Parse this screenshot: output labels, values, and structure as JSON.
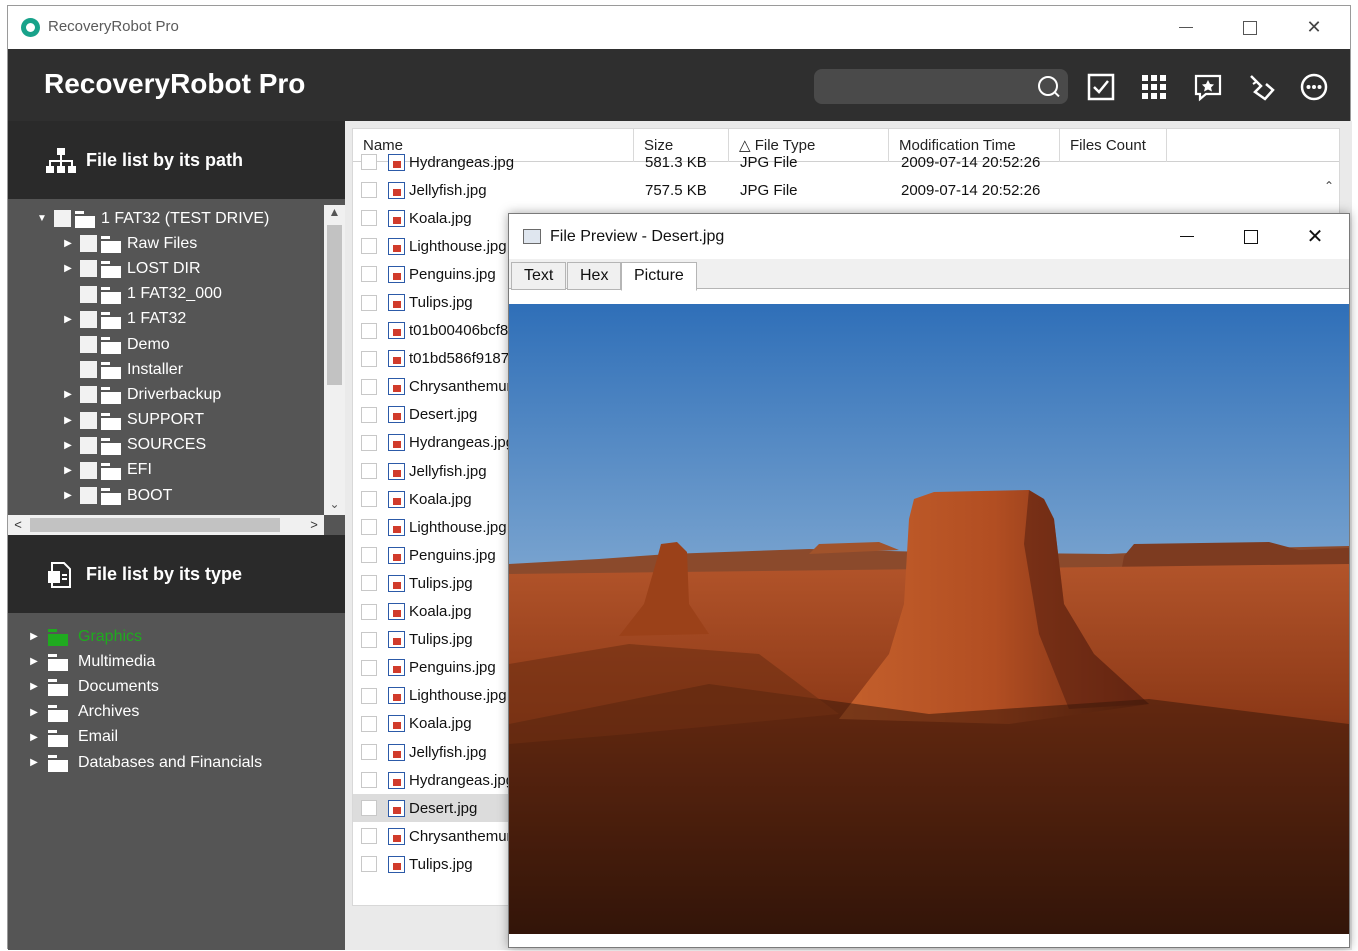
{
  "window": {
    "title": "RecoveryRobot Pro"
  },
  "header": {
    "brand": "RecoveryRobot Pro",
    "search": {
      "placeholder": ""
    },
    "tools": [
      "check-icon",
      "grid-icon",
      "rating-icon",
      "clean-icon",
      "more-icon"
    ]
  },
  "path_panel": {
    "title": "File list by its path",
    "tree": [
      {
        "label": "1 FAT32 (TEST DRIVE)",
        "level": 0,
        "arrow": "▼"
      },
      {
        "label": "Raw Files",
        "level": 1,
        "arrow": "▶"
      },
      {
        "label": "LOST DIR",
        "level": 1,
        "arrow": "▶"
      },
      {
        "label": "1 FAT32_000",
        "level": 1,
        "arrow": ""
      },
      {
        "label": "1 FAT32",
        "level": 1,
        "arrow": "▶"
      },
      {
        "label": "Demo",
        "level": 1,
        "arrow": ""
      },
      {
        "label": "Installer",
        "level": 1,
        "arrow": ""
      },
      {
        "label": "Driverbackup",
        "level": 1,
        "arrow": "▶"
      },
      {
        "label": "SUPPORT",
        "level": 1,
        "arrow": "▶"
      },
      {
        "label": "SOURCES",
        "level": 1,
        "arrow": "▶"
      },
      {
        "label": "EFI",
        "level": 1,
        "arrow": "▶"
      },
      {
        "label": "BOOT",
        "level": 1,
        "arrow": "▶"
      }
    ]
  },
  "type_panel": {
    "title": "File list by its type",
    "items": [
      {
        "label": "Graphics",
        "color": "#1faa1f"
      },
      {
        "label": "Multimedia",
        "color": "#ffffff"
      },
      {
        "label": "Documents",
        "color": "#ffffff"
      },
      {
        "label": "Archives",
        "color": "#ffffff"
      },
      {
        "label": "Email",
        "color": "#ffffff"
      },
      {
        "label": "Databases and Financials",
        "color": "#ffffff"
      }
    ]
  },
  "file_list": {
    "columns": [
      "Name",
      "Size",
      "△ File Type",
      "Modification Time",
      "Files Count"
    ],
    "rows": [
      {
        "name": "Hydrangeas.jpg",
        "size": "581.3 KB",
        "type": "JPG File",
        "modified": "2009-07-14 20:52:26"
      },
      {
        "name": "Jellyfish.jpg",
        "size": "757.5 KB",
        "type": "JPG File",
        "modified": "2009-07-14 20:52:26"
      },
      {
        "name": "Koala.jpg",
        "size": "",
        "type": "",
        "modified": ""
      },
      {
        "name": "Lighthouse.jpg",
        "size": "",
        "type": "",
        "modified": ""
      },
      {
        "name": "Penguins.jpg",
        "size": "",
        "type": "",
        "modified": ""
      },
      {
        "name": "Tulips.jpg",
        "size": "",
        "type": "",
        "modified": ""
      },
      {
        "name": "t01b00406bcf8",
        "size": "",
        "type": "",
        "modified": ""
      },
      {
        "name": "t01bd586f9187",
        "size": "",
        "type": "",
        "modified": ""
      },
      {
        "name": "Chrysanthemum",
        "size": "",
        "type": "",
        "modified": ""
      },
      {
        "name": "Desert.jpg",
        "size": "",
        "type": "",
        "modified": ""
      },
      {
        "name": "Hydrangeas.jpg",
        "size": "",
        "type": "",
        "modified": ""
      },
      {
        "name": "Jellyfish.jpg",
        "size": "",
        "type": "",
        "modified": ""
      },
      {
        "name": "Koala.jpg",
        "size": "",
        "type": "",
        "modified": ""
      },
      {
        "name": "Lighthouse.jpg",
        "size": "",
        "type": "",
        "modified": ""
      },
      {
        "name": "Penguins.jpg",
        "size": "",
        "type": "",
        "modified": ""
      },
      {
        "name": "Tulips.jpg",
        "size": "",
        "type": "",
        "modified": ""
      },
      {
        "name": "Koala.jpg",
        "size": "",
        "type": "",
        "modified": ""
      },
      {
        "name": "Tulips.jpg",
        "size": "",
        "type": "",
        "modified": ""
      },
      {
        "name": "Penguins.jpg",
        "size": "",
        "type": "",
        "modified": ""
      },
      {
        "name": "Lighthouse.jpg",
        "size": "",
        "type": "",
        "modified": ""
      },
      {
        "name": "Koala.jpg",
        "size": "",
        "type": "",
        "modified": ""
      },
      {
        "name": "Jellyfish.jpg",
        "size": "",
        "type": "",
        "modified": ""
      },
      {
        "name": "Hydrangeas.jpg",
        "size": "",
        "type": "",
        "modified": ""
      },
      {
        "name": "Desert.jpg",
        "size": "",
        "type": "",
        "modified": "",
        "selected": true
      },
      {
        "name": "Chrysanthemum",
        "size": "",
        "type": "",
        "modified": ""
      },
      {
        "name": "Tulips.jpg",
        "size": "",
        "type": "",
        "modified": ""
      }
    ]
  },
  "preview": {
    "title": "File Preview - Desert.jpg",
    "tabs": [
      "Text",
      "Hex",
      "Picture"
    ],
    "active_tab": "Picture"
  }
}
